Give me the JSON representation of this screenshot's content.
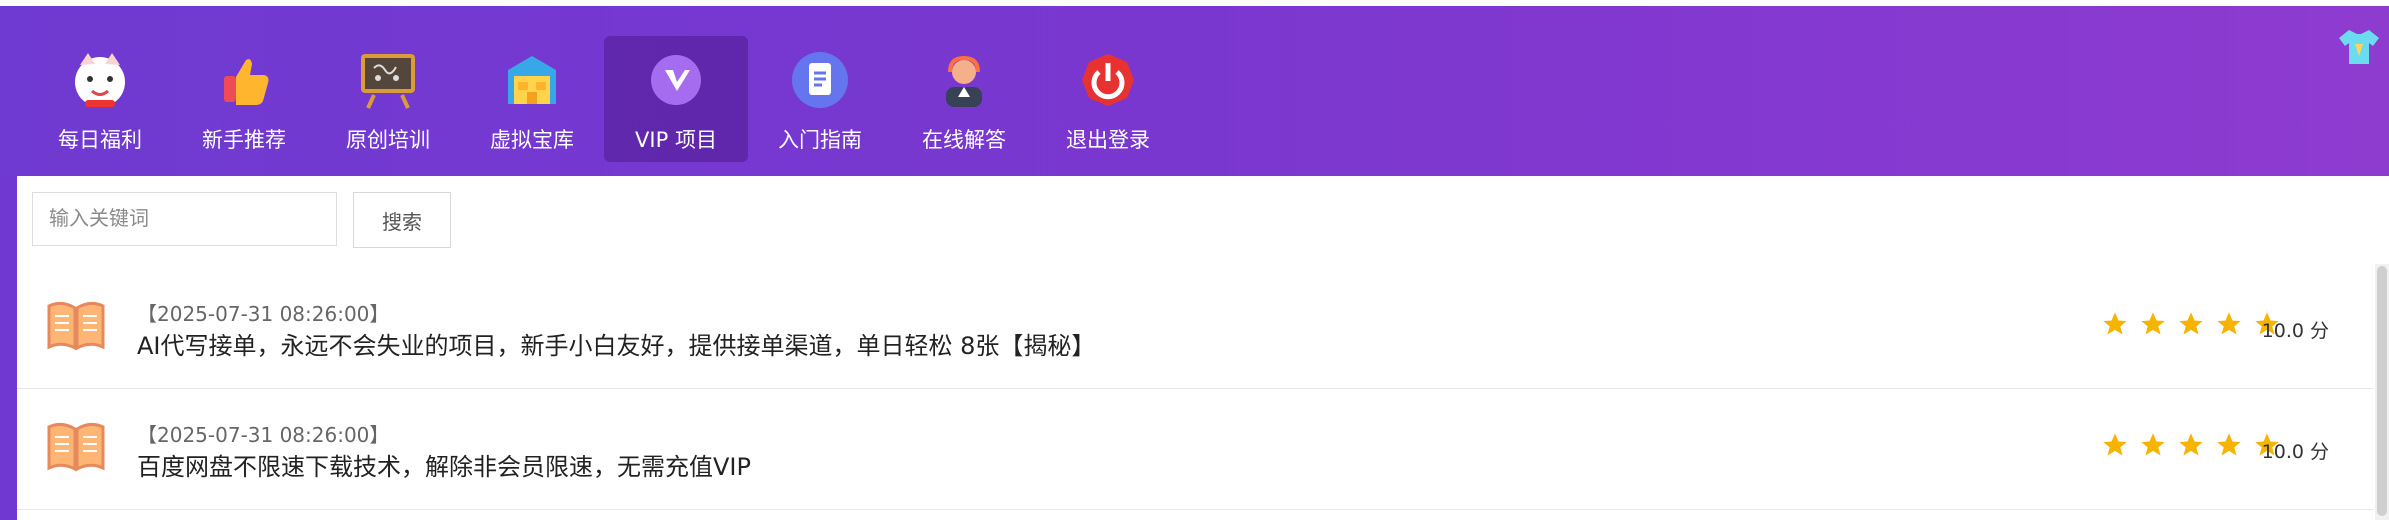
{
  "nav": {
    "items": [
      {
        "label": "每日福利",
        "icon": "lucky-cat-icon"
      },
      {
        "label": "新手推荐",
        "icon": "thumbs-up-icon"
      },
      {
        "label": "原创培训",
        "icon": "blackboard-icon"
      },
      {
        "label": "虚拟宝库",
        "icon": "warehouse-icon"
      },
      {
        "label": "VIP 项目",
        "icon": "vip-icon",
        "active": true
      },
      {
        "label": "入门指南",
        "icon": "document-icon"
      },
      {
        "label": "在线解答",
        "icon": "customer-support-icon"
      },
      {
        "label": "退出登录",
        "icon": "logout-icon"
      }
    ]
  },
  "search": {
    "placeholder": "输入关键词",
    "button": "搜索"
  },
  "list": [
    {
      "date": "【2025-07-31 08:26:00】",
      "title": "AI代写接单，永远不会失业的项目，新手小白友好，提供接单渠道，单日轻松 8张【揭秘】",
      "stars": 5,
      "score": "10.0 分"
    },
    {
      "date": "【2025-07-31 08:26:00】",
      "title": "百度网盘不限速下载技术，解除非会员限速，无需充值VIP",
      "stars": 5,
      "score": "10.0 分"
    }
  ],
  "colors": {
    "header_start": "#6f3ad1",
    "header_end": "#8e3bd0",
    "star": "#f6b400"
  }
}
